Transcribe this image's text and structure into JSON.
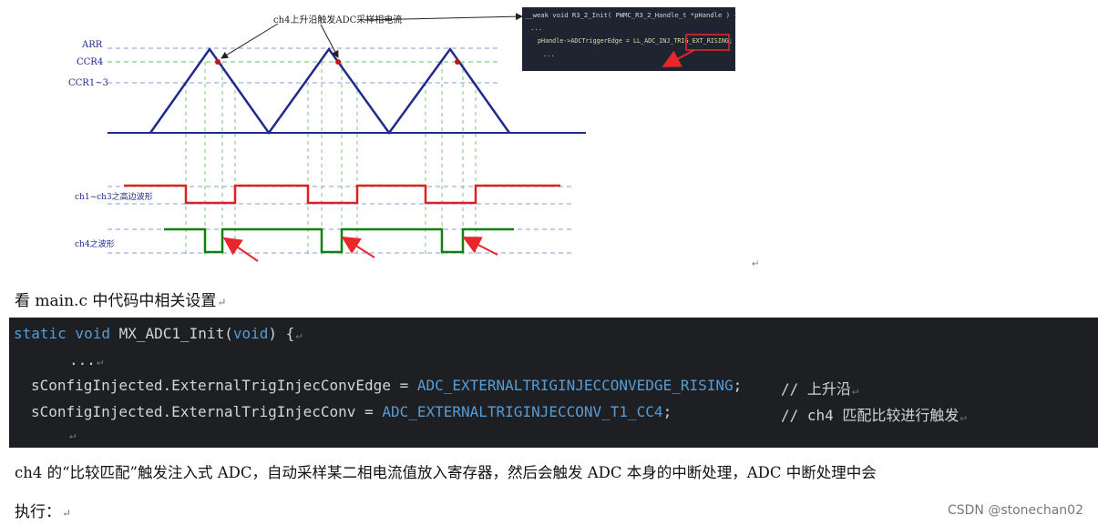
{
  "diagram": {
    "annotation": "ch4上升沿触发ADC采样相电流",
    "levels": {
      "arr": "ARR",
      "ccr4": "CCR4",
      "ccr13": "CCR1~3"
    },
    "wave_labels": {
      "ch13": "ch1~ch3之高边波形",
      "ch4": "ch4之波形"
    },
    "inset_code": {
      "line1": "__weak void R3_2_Init( PWMC_R3_2_Handle_t *pHandle ) {",
      "line2": "...",
      "line3": "pHandle->ADCTriggerEdge = LL_ADC_INJ_TRIG_EXT_RISING;",
      "line4": "..."
    },
    "colors": {
      "triangle": "#1f2a8a",
      "ch13": "#e02020",
      "ch4": "#118011",
      "arrow": "#e8262c",
      "guide": "#8a9be0"
    }
  },
  "intro_text": "看 main.c 中代码中相关设置",
  "code": {
    "line1_kw1": "static void",
    "line1_fn": " MX_ADC1_Init(",
    "line1_kw2": "void",
    "line1_end": ") {",
    "line2": "...",
    "line3_left": "sConfigInjected.ExternalTrigInjecConvEdge = ",
    "line3_val": "ADC_EXTERNALTRIGINJECCONVEDGE_RISING",
    "line3_semi": ";",
    "line3_comment": "// 上升沿",
    "line4_left": "sConfigInjected.ExternalTrigInjecConv = ",
    "line4_val": "ADC_EXTERNALTRIGINJECCONV_T1_CC4",
    "line4_semi": ";",
    "line4_comment": "// ch4 匹配比较进行触发"
  },
  "body_line1": "ch4 的“比较匹配”触发注入式 ADC，自动采样某二相电流值放入寄存器，然后会触发 ADC 本身的中断处理，ADC 中断处理中会",
  "body_line2": "执行：",
  "watermark": "CSDN @stonechan02"
}
